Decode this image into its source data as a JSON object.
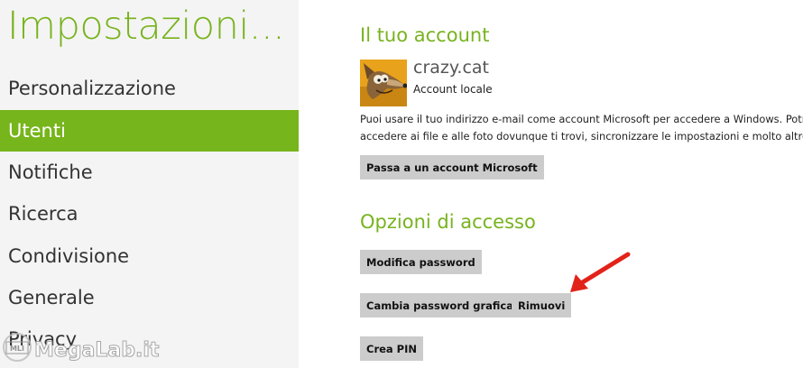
{
  "sidebar": {
    "title": "Impostazioni...",
    "items": [
      {
        "label": "Personalizzazione"
      },
      {
        "label": "Utenti"
      },
      {
        "label": "Notifiche"
      },
      {
        "label": "Ricerca"
      },
      {
        "label": "Condivisione"
      },
      {
        "label": "Generale"
      },
      {
        "label": "Privacy"
      }
    ],
    "selected": "Utenti"
  },
  "account": {
    "section_title": "Il tuo account",
    "name": "crazy.cat",
    "type": "Account locale",
    "description_line1": "Puoi usare il tuo indirizzo e-mail come account Microsoft per accedere a Windows. Potrai",
    "description_line2": "accedere ai file e alle foto dovunque ti trovi, sincronizzare le impostazioni e molto altro.",
    "switch_button": "Passa a un account Microsoft",
    "avatar_icon": "coyote-avatar-icon"
  },
  "access": {
    "section_title": "Opzioni di accesso",
    "change_password_button": "Modifica password",
    "change_picture_password_button": "Cambia password grafica",
    "remove_button": "Rimuovi",
    "create_pin_button": "Crea PIN"
  },
  "watermark": {
    "text": "MegaLab.it",
    "badge": "MLI"
  },
  "colors": {
    "accent": "#78b31e",
    "selected_bg": "#76b51b",
    "sidebar_bg": "#f4f4f4",
    "button_bg": "#cccccc",
    "arrow": "#e2231a"
  }
}
